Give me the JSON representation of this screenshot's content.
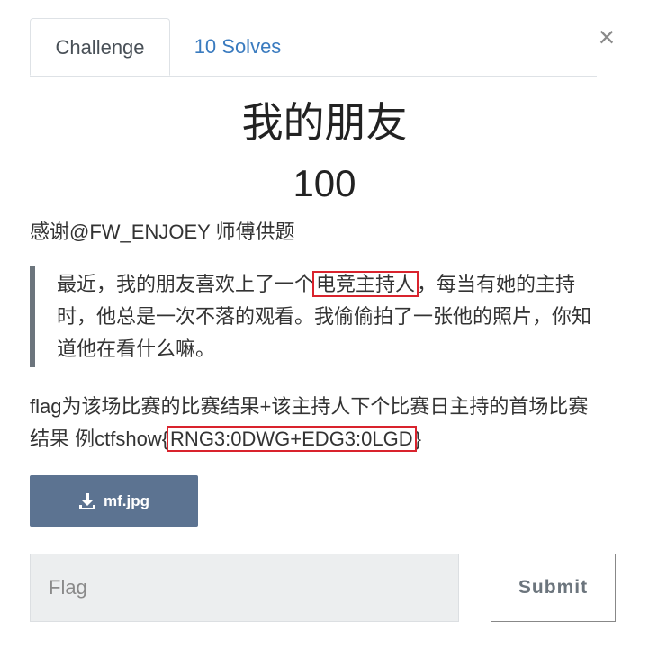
{
  "tabs": {
    "challenge": "Challenge",
    "solves": "10 Solves"
  },
  "close_icon": "×",
  "challenge": {
    "name": "我的朋友",
    "value": "100",
    "author": "感谢@FW_ENJOEY 师傅供题",
    "quote": {
      "part1": "最近，我的朋友喜欢上了一个",
      "highlight": "电竞主持人",
      "part2": "，每当有她的主持时，他总是一次不落的观看。我偷偷拍了一张他的照片，你知道他在看什么嘛。"
    },
    "description": {
      "part1": "flag为该场比赛的比赛结果+该主持人下个比赛日主持的首场比赛结果 例ctfshow{",
      "highlight": "RNG3:0DWG+EDG3:0LGD",
      "part2": "}"
    },
    "file": {
      "label": "mf.jpg",
      "icon": "download-icon"
    }
  },
  "form": {
    "flag_placeholder": "Flag",
    "flag_value": "",
    "submit_label": "Submit"
  },
  "colors": {
    "download_bg": "#5c7391",
    "link": "#3a7bbf",
    "highlight_border": "#d9232d",
    "quote_border": "#6c757d"
  }
}
